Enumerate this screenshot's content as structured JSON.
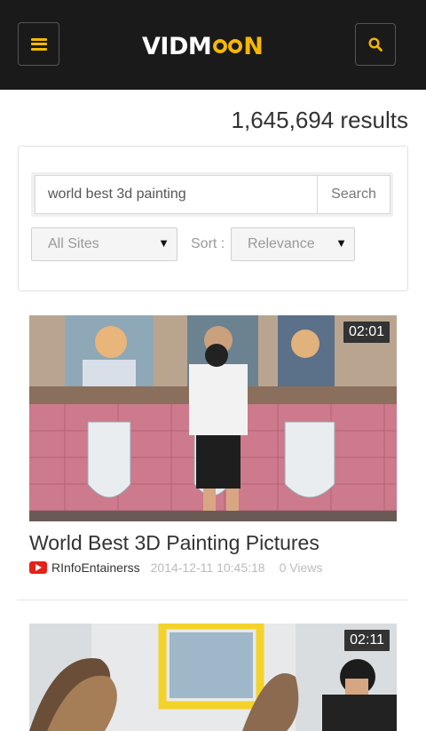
{
  "header": {
    "logo_text": "VIDMOON",
    "brand_color": "#f5b800",
    "menu_icon": "hamburger-icon",
    "search_icon": "search-icon"
  },
  "results_count": "1,645,694 results",
  "search": {
    "query": "world best 3d painting",
    "button_label": "Search",
    "site_filter": "All Sites",
    "sort_label": "Sort :",
    "sort_value": "Relevance"
  },
  "videos": [
    {
      "duration": "02:01",
      "title": "World Best 3D Painting Pictures",
      "channel": "RInfoEntainerss",
      "date": "2014-12-11 10:45:18",
      "views": "0 Views",
      "source_icon": "youtube-icon"
    },
    {
      "duration": "02:11"
    }
  ]
}
